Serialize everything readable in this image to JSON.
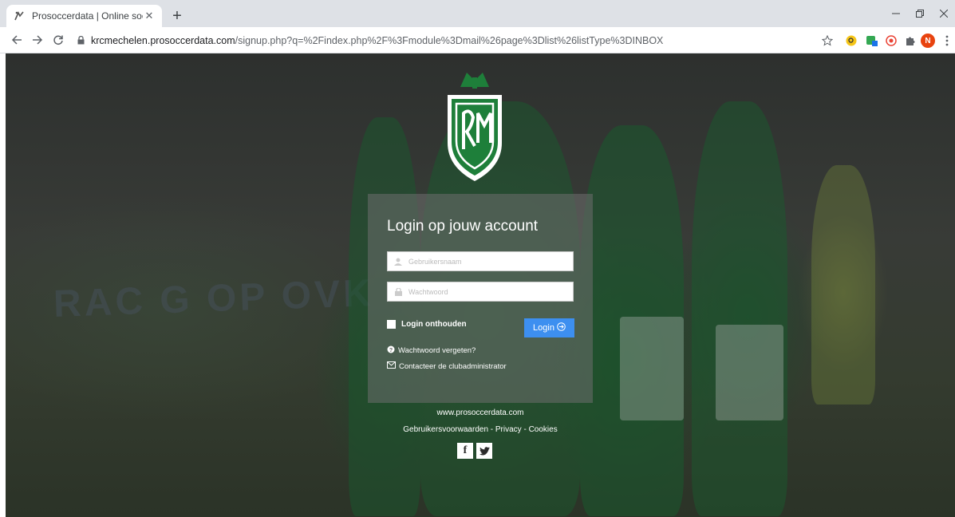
{
  "browser": {
    "tab_title": "Prosoccerdata | Online soccer ma",
    "tab_close": "✕",
    "new_tab": "+",
    "url_host": "krcmechelen.prosoccerdata.com",
    "url_path": "/signup.php?q=%2Findex.php%2F%3Fmodule%3Dmail%26page%3Dlist%26listType%3DINBOX",
    "profile_initial": "N"
  },
  "login": {
    "heading": "Login op jouw account",
    "username_placeholder": "Gebruikersnaam",
    "password_placeholder": "Wachtwoord",
    "remember_label": "Login onthouden",
    "login_button": "Login",
    "forgot_password": "Wachtwoord vergeten?",
    "contact_admin": "Contacteer de clubadministrator"
  },
  "footer": {
    "site": "www.prosoccerdata.com",
    "terms": "Gebruikersvoorwaarden",
    "privacy": "Privacy",
    "cookies": "Cookies",
    "separator": " - "
  },
  "social": {
    "facebook": "f",
    "twitter": "t"
  },
  "background": {
    "banner_text": "RAC  G OP OVK"
  },
  "colors": {
    "accent": "#3d8ff0",
    "logo_green": "#1e7f3a"
  }
}
